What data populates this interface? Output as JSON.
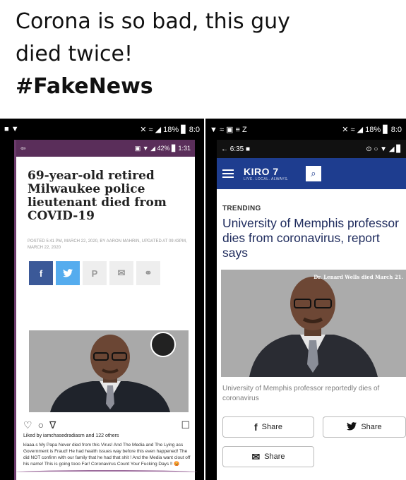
{
  "caption": {
    "line1": "Corona is so bad, this guy",
    "line2": "died twice!",
    "hashtag": "#FakeNews"
  },
  "left_panel": {
    "status": {
      "left_icons": "■ ▼",
      "right": "✕ ≈ ◢ 18% ▊ 8:0"
    },
    "inner_status": {
      "right": "▣ ▼ ◢ 42% ▊ 1:31"
    },
    "headline": "69-year-old retired Milwaukee police lieutenant died from COVID-19",
    "meta": "POSTED 5:41 PM, MARCH 22, 2020, BY AARON MAHRIN, UPDATED AT 09:43PM, MARCH 22, 2020",
    "share_buttons": [
      "f",
      "🐦",
      "P",
      "✉",
      "⚭"
    ],
    "likes": "Liked by iamchasedradiasm and 122 others",
    "comment": "kiaaa.s My Papa Never died from this Virus! And The Media and The Lying ass Government is Fraud! He had health issues way before this even happened! The did NOT confirm with our family that he had that shit ! And the Media want clout off his name! This is going tooo Far! Coronavirus Count Your Fucking Days !! 😡"
  },
  "right_panel": {
    "status": {
      "left": "▼ ≈ ▣ ≡ Z",
      "right": "✕ ≈ ◢ 18% ▊ 8:0"
    },
    "inner_status": {
      "left": "← 6:35 ■",
      "right": "⊙ ○ ▼ ◢ ▊"
    },
    "brand": "KIRO 7",
    "brand_sub": "LIVE. LOCAL. ALWAYS.",
    "trending": "TRENDING",
    "headline": "University of Memphis professor dies from coronavirus, report says",
    "photo_label": "Dr. Lenard Wells died March 21.",
    "caption": "University of Memphis professor reportedly dies of coronavirus",
    "share_facebook": "Share",
    "share_twitter": "Share",
    "share_email": "Share"
  }
}
